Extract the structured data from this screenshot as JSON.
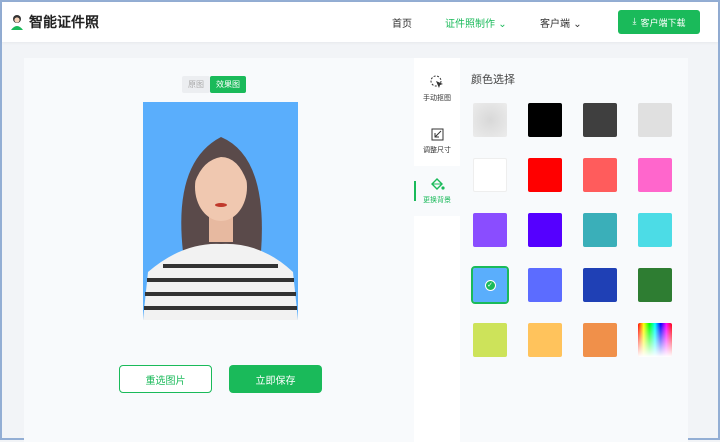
{
  "header": {
    "title": "智能证件照",
    "nav": [
      {
        "label": "首页"
      },
      {
        "label": "证件照制作",
        "active": true
      },
      {
        "label": "客户端"
      }
    ],
    "download_label": "客户端下载"
  },
  "editor": {
    "toggle": {
      "original": "原图",
      "result": "效果图"
    },
    "reselect_label": "重选图片",
    "save_label": "立即保存",
    "background_color": "#5aaefc"
  },
  "sidebar": {
    "items": [
      {
        "label": "手动抠图",
        "icon": "cursor-icon"
      },
      {
        "label": "调整尺寸",
        "icon": "resize-icon"
      },
      {
        "label": "更换背景",
        "icon": "paint-bucket-icon",
        "active": true
      }
    ]
  },
  "panel": {
    "title": "颜色选择",
    "swatches": [
      "transparent",
      "#000000",
      "#3f3f3f",
      "#e0e0e0",
      "#ffffff",
      "#ff0000",
      "#ff5c5c",
      "#ff66cc",
      "#8a4dff",
      "#5500ff",
      "#3aafb9",
      "#4cdce6",
      "#5aaefc",
      "#5c6cff",
      "#1f40b5",
      "#2e7d32",
      "#cde35a",
      "#ffc35c",
      "#f0904a",
      "rainbow"
    ],
    "selected_index": 12
  },
  "accent": "#1aba5a"
}
